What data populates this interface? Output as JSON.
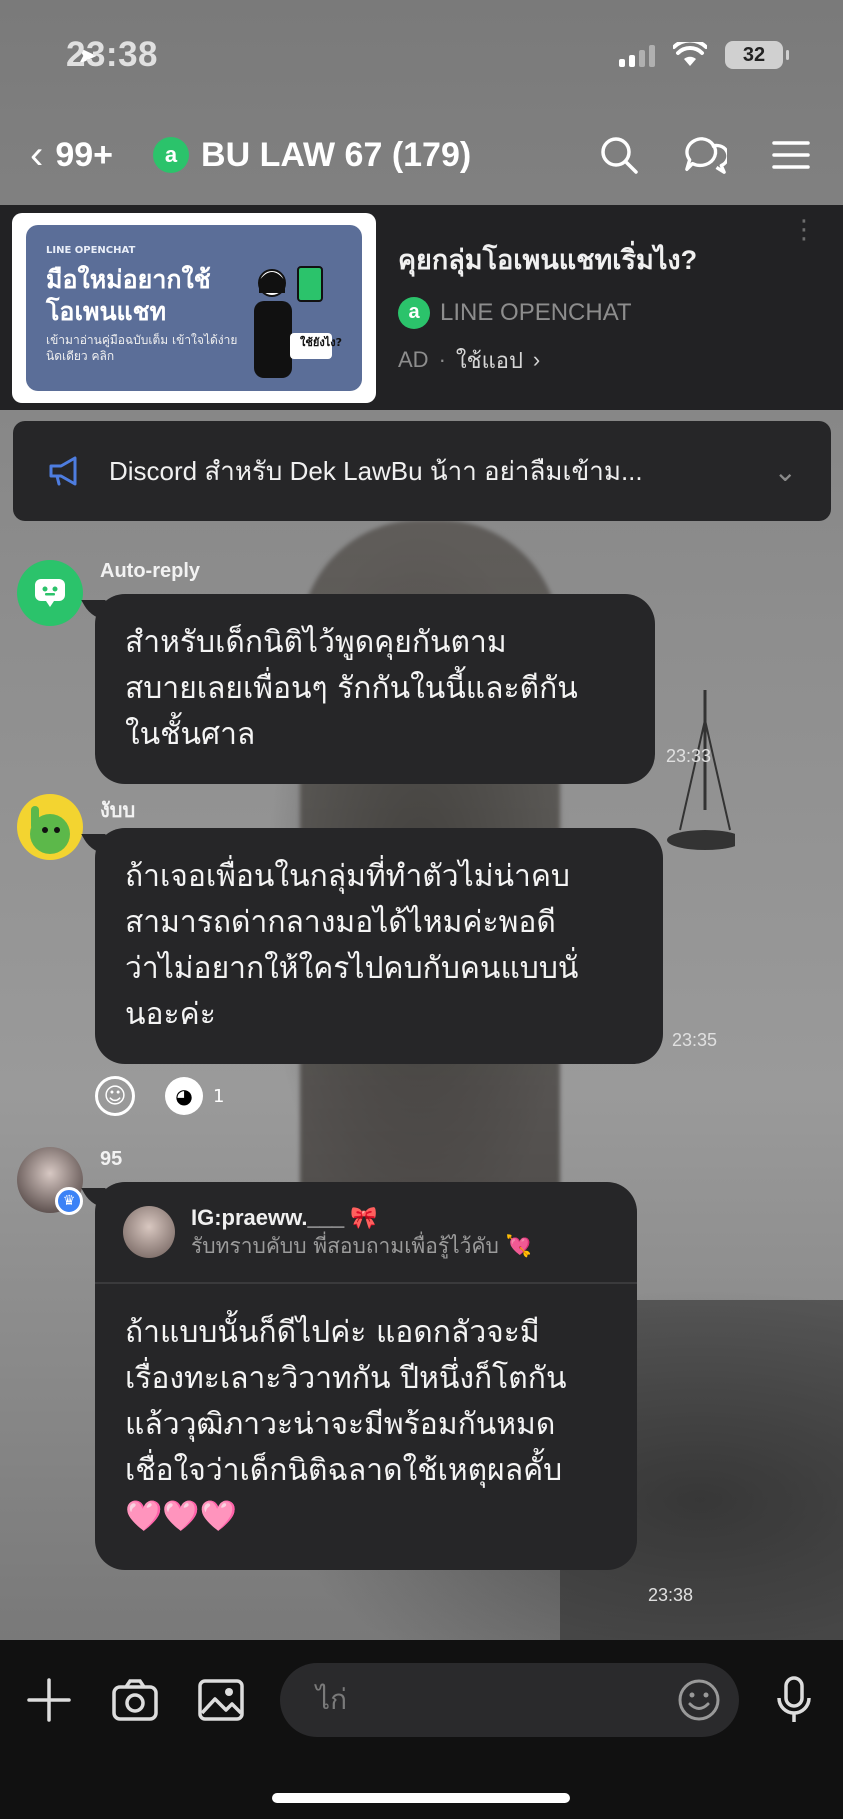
{
  "status_bar": {
    "time": "23:38",
    "battery": "32"
  },
  "header": {
    "back_count": "99+",
    "title": "BU LAW 67 (179)"
  },
  "ad": {
    "thumb_small": "LINE OPENCHAT",
    "thumb_headline": "มือใหม่อยากใช้ โอเพนแชท",
    "thumb_sub": "เข้ามาอ่านคู่มือฉบับเต็ม เข้าใจได้ง่ายนิดเดียว คลิก",
    "thumb_bubble": "ใช้ยังไง?",
    "title": "คุยกลุ่มโอเพนแชทเริ่มไง?",
    "brand": "LINE OPENCHAT",
    "label": "AD",
    "action": "ใช้แอป"
  },
  "announcement": {
    "text": "Discord สำหรับ Dek LawBu น้าา อย่าลืมเข้าม..."
  },
  "messages": [
    {
      "sender": "Auto-reply",
      "lines": [
        "สำหรับเด็กนิติไว้พูดคุยกันตาม",
        "สบายเลยเพื่อนๆ รักกันในนี้และตีกัน",
        "ในชั้นศาล"
      ],
      "time": "23:33"
    },
    {
      "sender": "งับบ",
      "lines": [
        "ถ้าเจอเพื่อนในกลุ่มที่ทำตัวไม่น่าคบ",
        "สามารถด่ากลางมอได้ไหมค่ะพอดี",
        "ว่าไม่อยากให้ใครไปคบกับคนแบบนั่",
        "นอะค่ะ"
      ],
      "time": "23:35",
      "reaction_count": "1"
    },
    {
      "sender": "95",
      "reply_to": {
        "name": "IG:praeww.___ 🎀",
        "text": "รับทราบคับบ พี่สอบถามเพื่อรู้ไว้คับ 💘"
      },
      "lines": [
        "ถ้าแบบนั้นก็ดีไปค่ะ แอดกลัวจะมี",
        "เรื่องทะเลาะวิวาทกัน ปีหนึ่งก็โตกัน",
        "แล้ววุฒิภาวะน่าจะมีพร้อมกันหมด",
        "เชื่อใจว่าเด็กนิติฉลาดใช้เหตุผลคั้บ",
        "🩷🩷🩷"
      ],
      "time": "23:38"
    }
  ],
  "input": {
    "placeholder": "ไก่"
  },
  "colors": {
    "line_green": "#2bc36b",
    "bubble": "#262628",
    "announce_icon": "#4e7de0"
  }
}
